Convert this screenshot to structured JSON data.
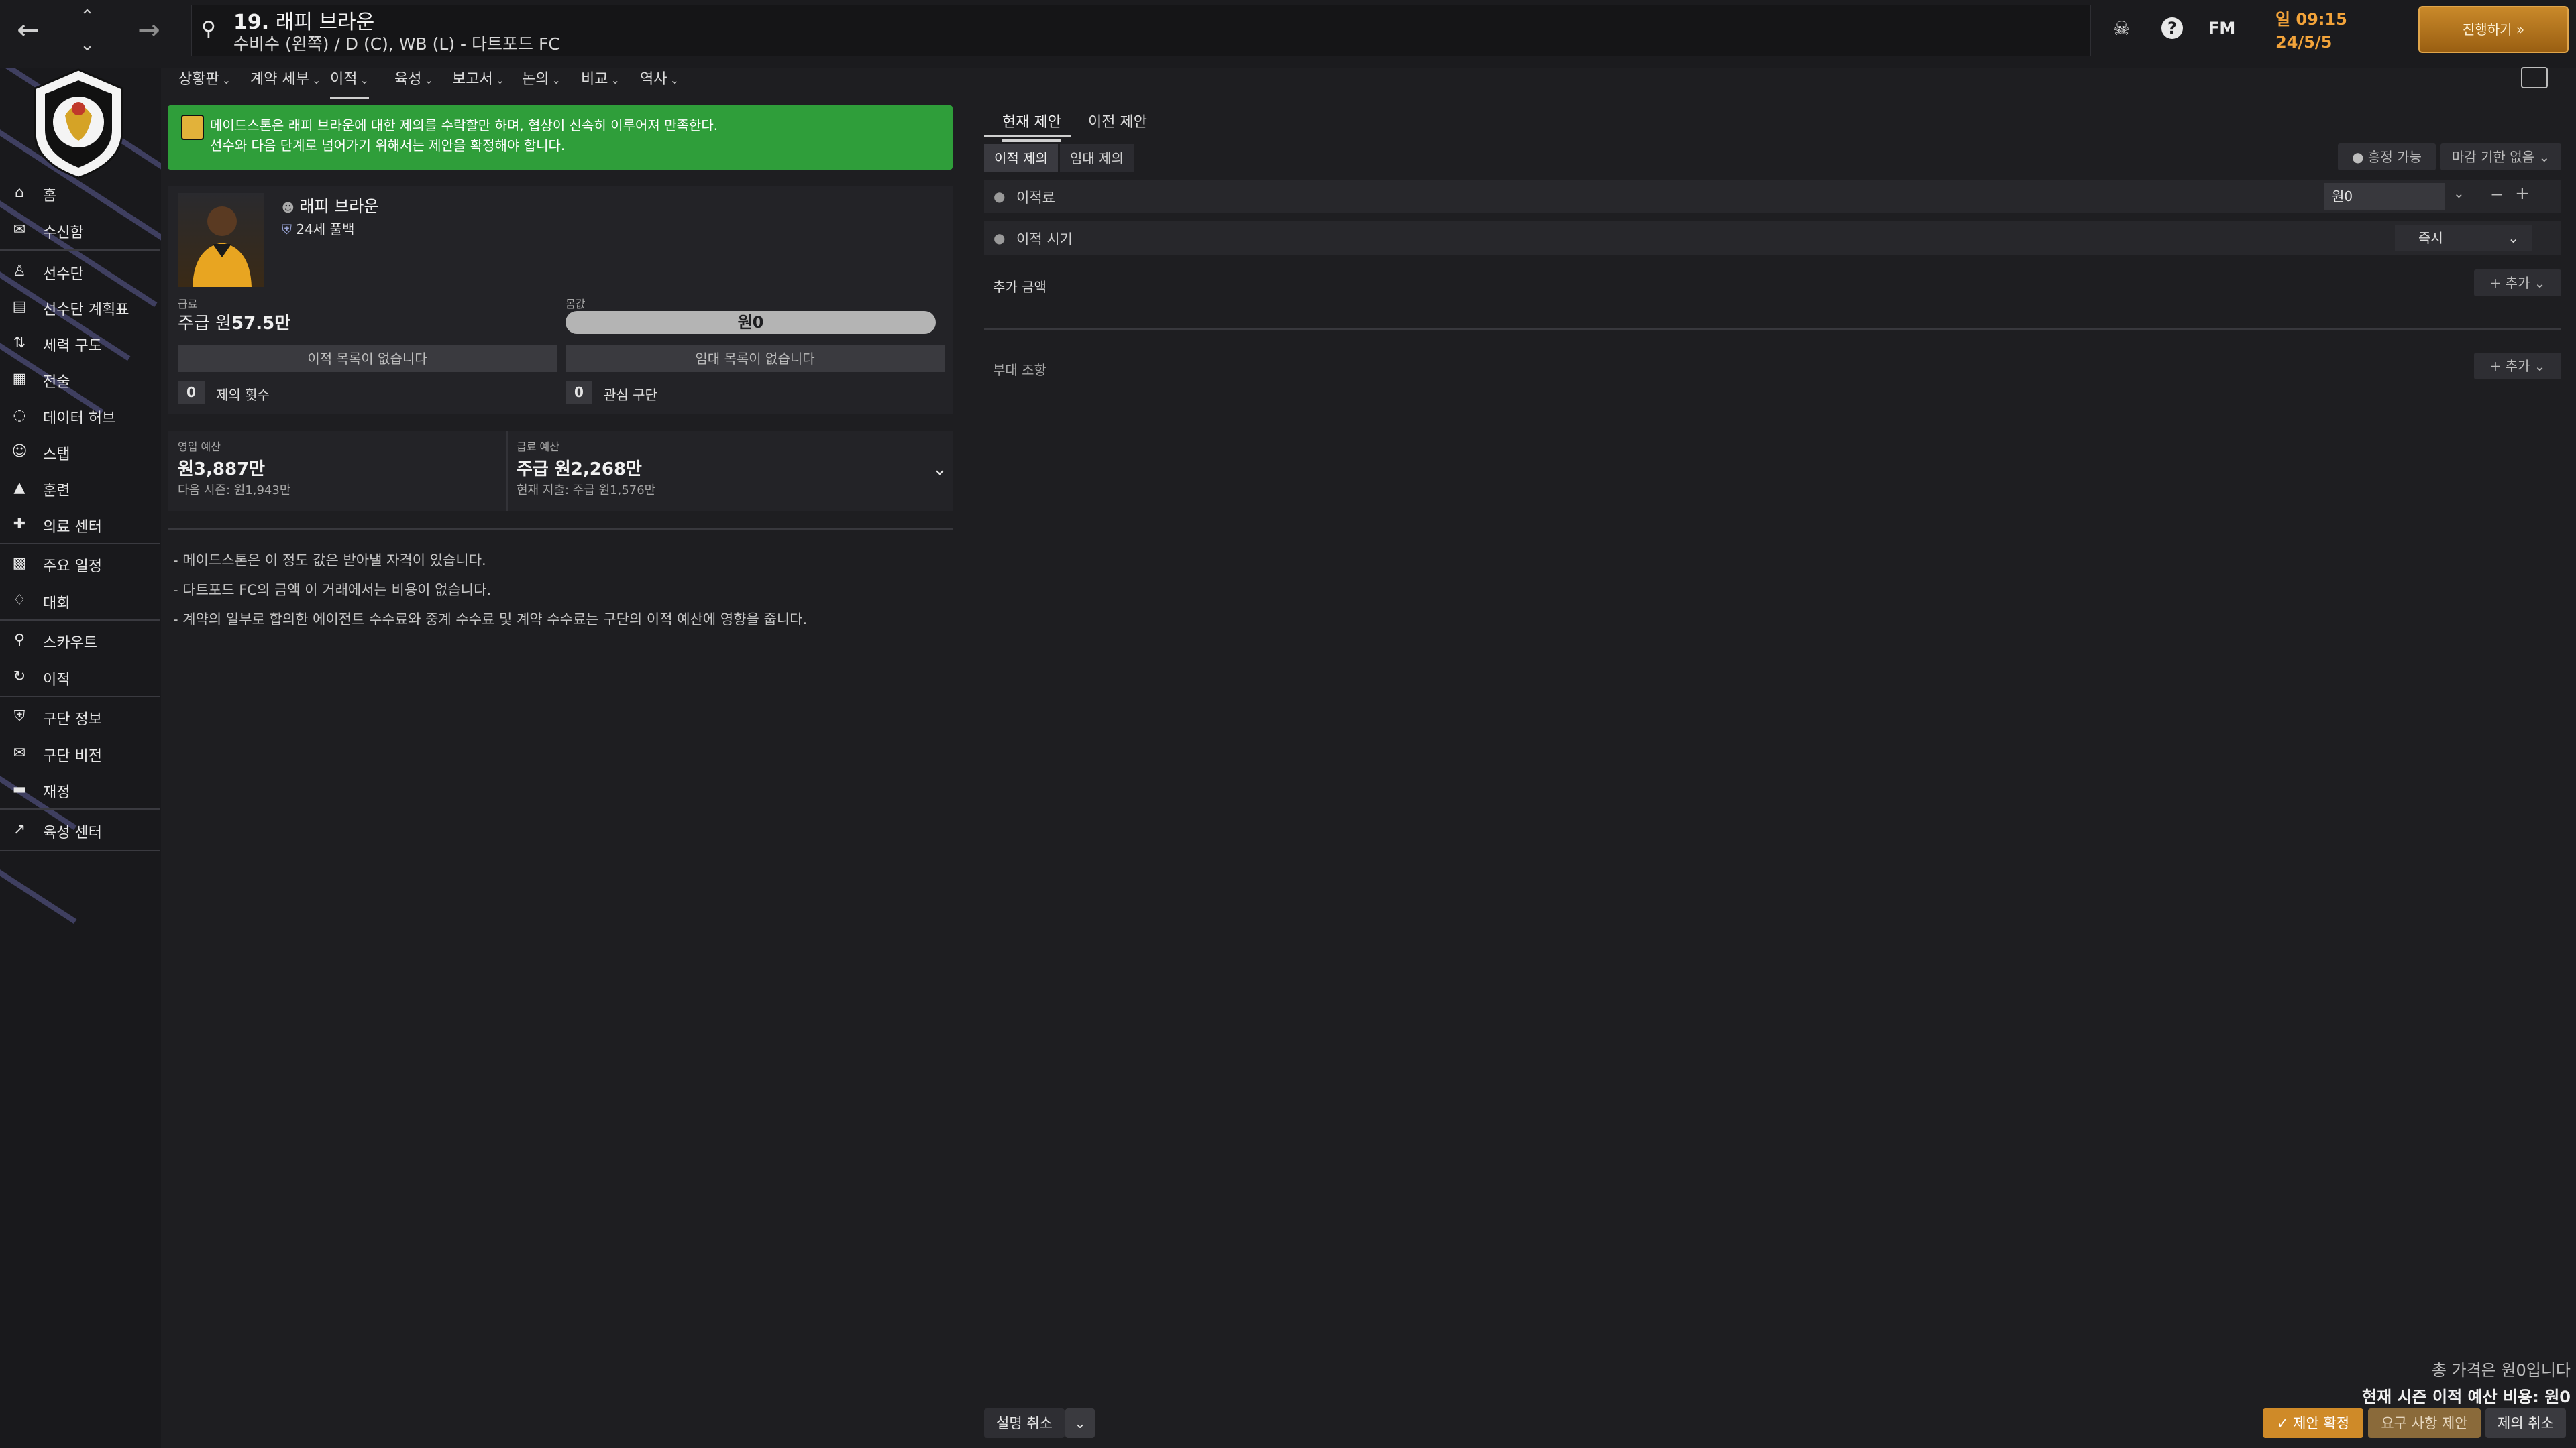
{
  "header": {
    "title_number": "19.",
    "title_name": "래피 브라운",
    "subtitle": "수비수 (왼쪽) / D (C), WB (L) - 다트포드 FC",
    "fm_label": "FM",
    "clock_day": "일 09:15",
    "clock_date": "24/5/5",
    "continue_label": "진행하기"
  },
  "sidebar": {
    "items": [
      {
        "label": "홈",
        "icon": "home-icon"
      },
      {
        "label": "수신함",
        "icon": "inbox-icon"
      },
      {
        "label": "선수단",
        "icon": "shirt-icon"
      },
      {
        "label": "선수단 계획표",
        "icon": "clipboard-icon"
      },
      {
        "label": "세력 구도",
        "icon": "dynamics-icon"
      },
      {
        "label": "전술",
        "icon": "tactics-icon"
      },
      {
        "label": "데이터 허브",
        "icon": "data-hub-icon"
      },
      {
        "label": "스탭",
        "icon": "staff-icon"
      },
      {
        "label": "훈련",
        "icon": "training-icon"
      },
      {
        "label": "의료 센터",
        "icon": "medical-icon"
      },
      {
        "label": "주요 일정",
        "icon": "calendar-icon"
      },
      {
        "label": "대회",
        "icon": "trophy-icon"
      },
      {
        "label": "스카우트",
        "icon": "scout-icon"
      },
      {
        "label": "이적",
        "icon": "transfer-icon"
      },
      {
        "label": "구단 정보",
        "icon": "club-info-icon"
      },
      {
        "label": "구단 비전",
        "icon": "vision-icon"
      },
      {
        "label": "재정",
        "icon": "finance-icon"
      },
      {
        "label": "육성 센터",
        "icon": "development-icon"
      }
    ]
  },
  "subtabs": [
    "상황판",
    "계약 세부",
    "이적",
    "육성",
    "보고서",
    "논의",
    "비교",
    "역사"
  ],
  "banner": {
    "line1": "메이드스톤은 래피 브라운에 대한 제의를 수락할만 하며, 협상이 신속히 이루어져 만족한다.",
    "line2": "선수와 다음 단계로 넘어가기 위해서는 제안을 확정해야 합니다."
  },
  "player": {
    "name": "래피 브라운",
    "age_pos": "24세 풀백",
    "wage_label": "급료",
    "wage_prefix": "주급 원",
    "wage_value": "57.5만",
    "value_label": "몸값",
    "value": "원0",
    "no_transfer": "이적 목록이 없습니다",
    "no_loan": "임대 목록이 없습니다",
    "offers_count": "0",
    "offers_label": "제의 횟수",
    "interest_count": "0",
    "interest_label": "관심 구단"
  },
  "budget": {
    "transfer_label": "영입 예산",
    "transfer_value": "원3,887만",
    "transfer_next": "다음 시즌: 원1,943만",
    "wage_label": "급료 예산",
    "wage_value": "주급 원2,268만",
    "wage_current": "현재 지출: 주급 원1,576만"
  },
  "notes": [
    "- 메이드스톤은 이 정도 값은 받아낼 자격이 있습니다.",
    "- 다트포드 FC의 금액 이 거래에서는 비용이 없습니다.",
    "- 계약의 일부로 합의한 에이전트 수수료와 중계 수수료 및 계약 수수료는 구단의 이적 예산에 영향을 줍니다."
  ],
  "offer": {
    "tab_current": "현재 제안",
    "tab_previous": "이전 제안",
    "seg_transfer": "이적 제의",
    "seg_loan": "임대 제의",
    "negotiable": "흥정 가능",
    "no_deadline": "마감 기한 없음",
    "fee_label": "이적료",
    "fee_value": "원0",
    "timing_label": "이적 시기",
    "timing_value": "즉시",
    "extra_label": "추가 금액",
    "add_label": "+ 추가",
    "clause_label": "부대 조항",
    "total_price": "총 가격은 원0입니다",
    "season_cost": "현재 시즌 이적 예산 비용: 원0",
    "cancel_explain": "설명 취소",
    "confirm": "✓ 제안 확정",
    "request": "요구 사항 제안",
    "cancel_offer": "제의 취소"
  }
}
